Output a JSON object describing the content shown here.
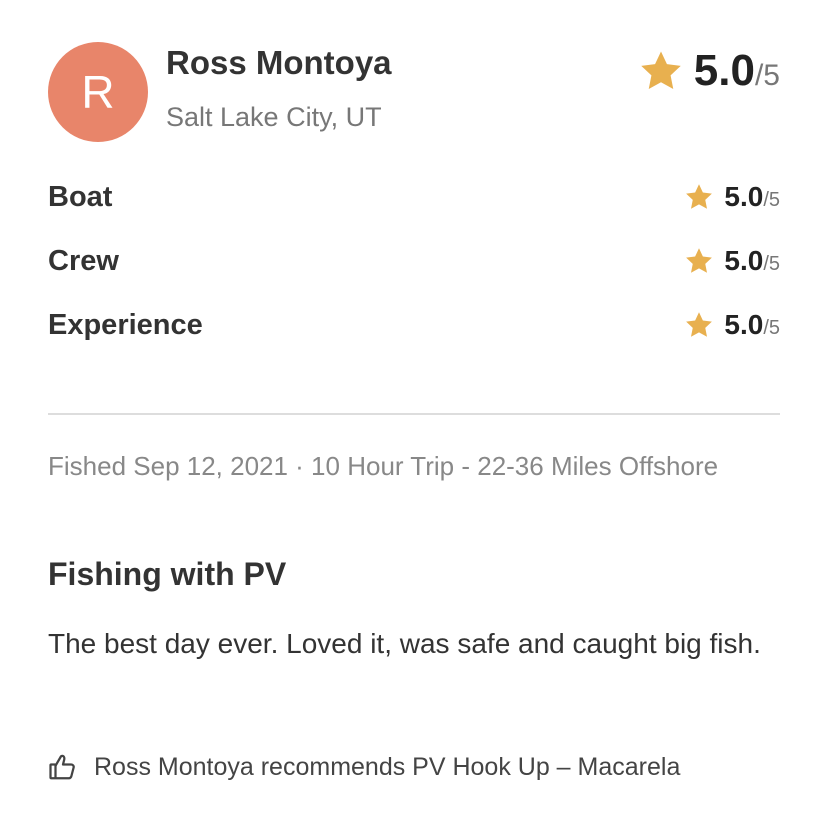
{
  "reviewer": {
    "initial": "R",
    "name": "Ross Montoya",
    "location": "Salt Lake City, UT",
    "avatar_color": "#e8856a"
  },
  "overall_rating": {
    "score": "5.0",
    "out_of": "/5",
    "icon": "star-icon",
    "star_color": "#e8b04f"
  },
  "category_ratings": [
    {
      "label": "Boat",
      "score": "5.0",
      "out_of": "/5"
    },
    {
      "label": "Crew",
      "score": "5.0",
      "out_of": "/5"
    },
    {
      "label": "Experience",
      "score": "5.0",
      "out_of": "/5"
    }
  ],
  "trip": {
    "details": "Fished Sep 12, 2021 · 10 Hour Trip - 22-36 Miles Offshore"
  },
  "review": {
    "title": "Fishing with PV",
    "body": "The best day ever. Loved it, was safe and caught big fish."
  },
  "recommendation": {
    "icon": "thumbs-up-icon",
    "text": "Ross Montoya recommends PV Hook Up – Macarela"
  }
}
